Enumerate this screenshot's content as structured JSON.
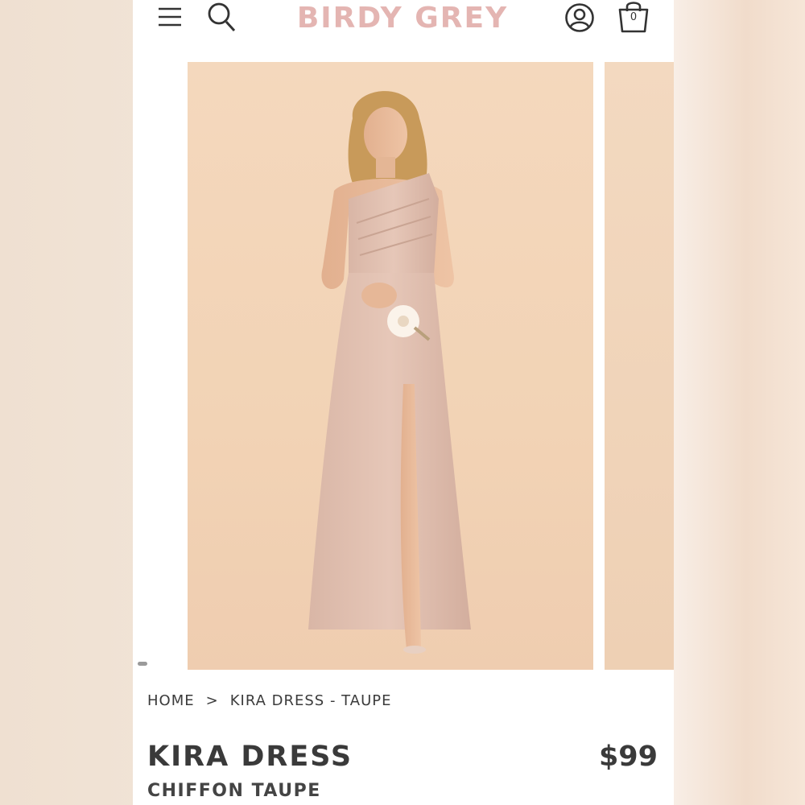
{
  "header": {
    "brand": "BIRDY GREY",
    "brand_color": "#e4b5b2",
    "menu_icon": "hamburger-menu-icon",
    "search_icon": "search-icon",
    "account_icon": "user-account-icon",
    "bag_icon": "shopping-bag-icon",
    "bag_count": "0"
  },
  "gallery": {
    "main_image": "model wearing one-shoulder long chiffon dress with front slit holding a white flower",
    "dot_indicator": "carousel-dot"
  },
  "breadcrumb": {
    "home": "HOME",
    "separator": ">",
    "current": "KIRA DRESS - TAUPE"
  },
  "product": {
    "title": "KIRA DRESS",
    "subtitle": "CHIFFON TAUPE",
    "price": "$99"
  }
}
